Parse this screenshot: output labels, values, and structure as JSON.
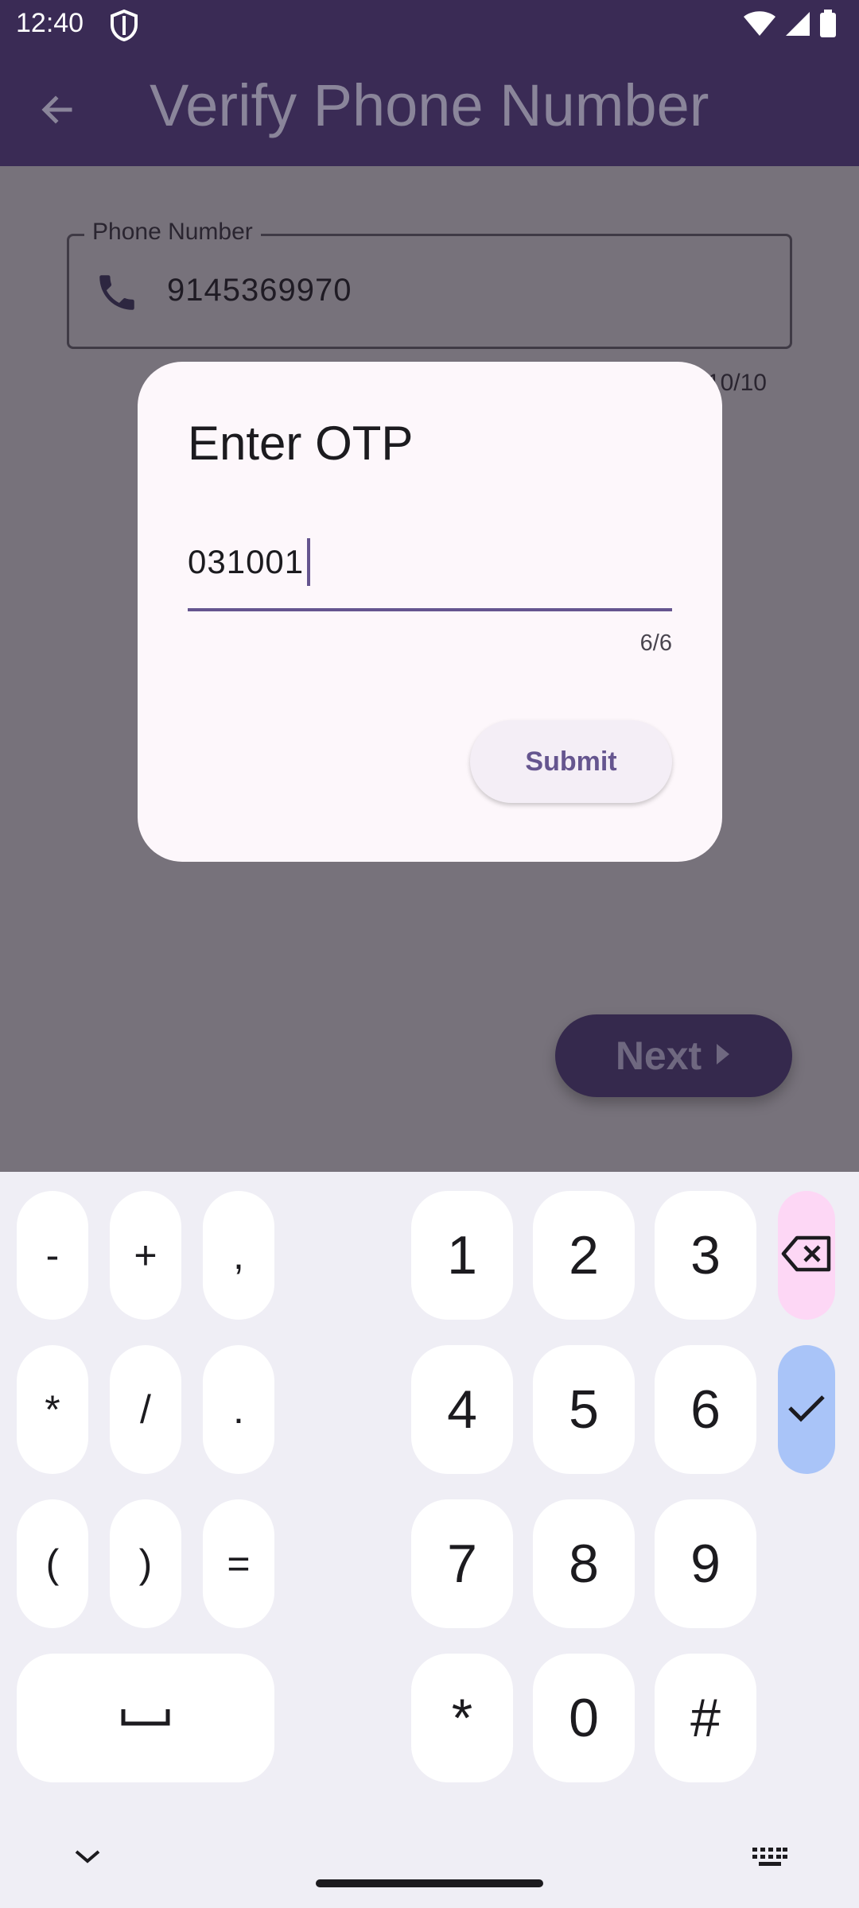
{
  "status_bar": {
    "time": "12:40",
    "icons": [
      "shield-icon",
      "wifi-icon",
      "signal-icon",
      "battery-icon"
    ]
  },
  "app_bar": {
    "title": "Verify Phone Number",
    "back_icon": "arrow-back-icon"
  },
  "phone_field": {
    "label": "Phone Number",
    "value": "9145369970",
    "counter": "10/10",
    "icon": "phone-icon"
  },
  "next_button": {
    "label": "Next",
    "icon": "arrow-right-icon"
  },
  "dialog": {
    "title": "Enter OTP",
    "otp_value": "031001",
    "counter": "6/6",
    "submit_label": "Submit"
  },
  "keyboard": {
    "symbol_keys": [
      "-",
      "+",
      ",",
      "*",
      "/",
      ".",
      "(",
      ")",
      "="
    ],
    "number_keys": [
      "1",
      "2",
      "3",
      "4",
      "5",
      "6",
      "7",
      "8",
      "9",
      "*",
      "0",
      "#"
    ],
    "space_icon": "space-bar-icon",
    "backspace_icon": "backspace-icon",
    "enter_icon": "check-icon",
    "hide_icon": "chevron-down-icon",
    "switch_icon": "keyboard-icon"
  },
  "colors": {
    "app_bar": "#3a2b55",
    "scrim": "#77727b",
    "dialog": "#fdf7fb",
    "accent": "#65558f",
    "keyboard_bg": "#efeef5",
    "backspace_key": "#fdd7f5",
    "enter_key": "#a9c4f8"
  }
}
